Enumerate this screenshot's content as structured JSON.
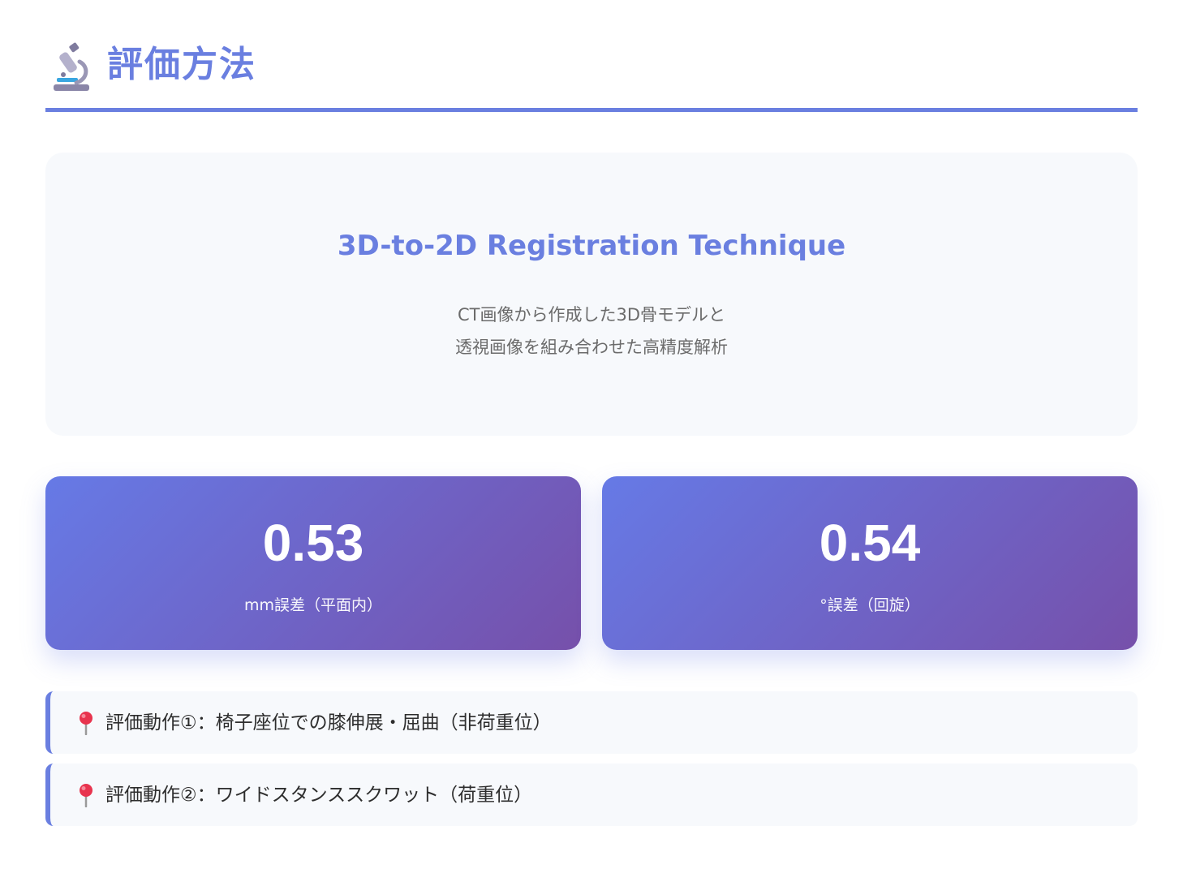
{
  "header": {
    "icon": "microscope-icon",
    "title": "評価方法"
  },
  "registration": {
    "title": "3D-to-2D Registration Technique",
    "description_line1": "CT画像から作成した3D骨モデルと",
    "description_line2": "透視画像を組み合わせた高精度解析"
  },
  "stats": [
    {
      "value": "0.53",
      "label": "mm誤差（平面内）"
    },
    {
      "value": "0.54",
      "label": "°誤差（回旋）"
    }
  ],
  "motions": [
    {
      "icon": "pin-icon",
      "text": "評価動作①：椅子座位での膝伸展・屈曲（非荷重位）"
    },
    {
      "icon": "pin-icon",
      "text": "評価動作②：ワイドスタンススクワット（荷重位）"
    }
  ],
  "colors": {
    "accent": "#6a7fe0",
    "gradient_start": "#667ae6",
    "gradient_end": "#7650aa",
    "card_background": "#f7f9fc"
  }
}
